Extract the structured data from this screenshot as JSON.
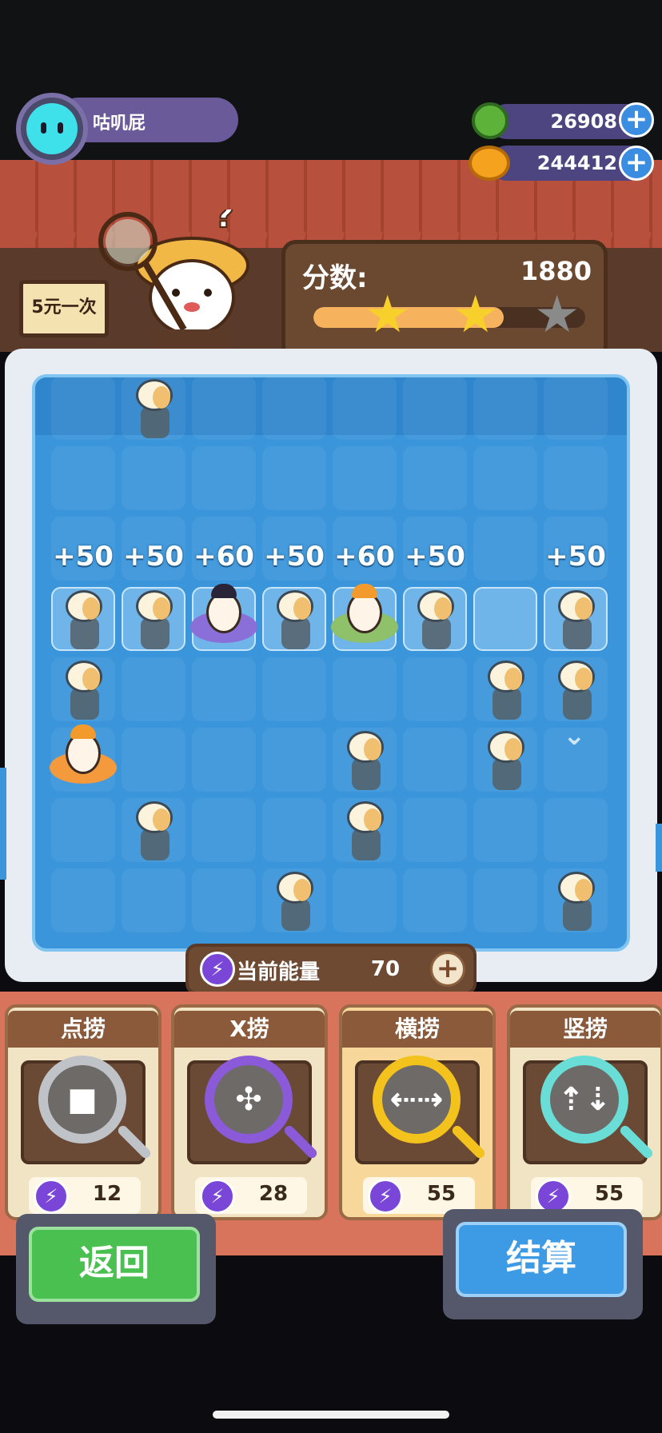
{
  "player": {
    "name": "咕叽屁"
  },
  "currencies": [
    {
      "id": "gem",
      "icon": "green-coin-icon",
      "value": "26908"
    },
    {
      "id": "gold",
      "icon": "planet-coin-icon",
      "value": "244412"
    }
  ],
  "shop_sign": "5元一次",
  "score": {
    "label": "分数:",
    "value": "1880",
    "progress": 0.7,
    "stars_earned": 2,
    "stars_total": 3
  },
  "board": {
    "cols": 8,
    "rows": 8,
    "bonus_labels": [
      {
        "col": 0,
        "text": "+50"
      },
      {
        "col": 1,
        "text": "+50"
      },
      {
        "col": 2,
        "text": "+60"
      },
      {
        "col": 3,
        "text": "+50"
      },
      {
        "col": 4,
        "text": "+60"
      },
      {
        "col": 5,
        "text": "+50"
      },
      {
        "col": 7,
        "text": "+50"
      }
    ],
    "highlighted_row": 3,
    "pieces": [
      {
        "type": "jellyfish",
        "col": 1,
        "row": 0
      },
      {
        "type": "jellyfish",
        "col": 0,
        "row": 3
      },
      {
        "type": "jellyfish",
        "col": 1,
        "row": 3
      },
      {
        "type": "duck-purple-ring",
        "col": 2,
        "row": 3
      },
      {
        "type": "jellyfish",
        "col": 3,
        "row": 3
      },
      {
        "type": "duck-green-ring",
        "col": 4,
        "row": 3
      },
      {
        "type": "jellyfish",
        "col": 5,
        "row": 3
      },
      {
        "type": "jellyfish",
        "col": 7,
        "row": 3
      },
      {
        "type": "jellyfish",
        "col": 0,
        "row": 4
      },
      {
        "type": "jellyfish",
        "col": 6,
        "row": 4
      },
      {
        "type": "jellyfish",
        "col": 7,
        "row": 4
      },
      {
        "type": "duck-orange-ring",
        "col": 0,
        "row": 5
      },
      {
        "type": "jellyfish",
        "col": 4,
        "row": 5
      },
      {
        "type": "jellyfish",
        "col": 6,
        "row": 5
      },
      {
        "type": "jellyfish",
        "col": 1,
        "row": 6
      },
      {
        "type": "jellyfish",
        "col": 4,
        "row": 6
      },
      {
        "type": "jellyfish",
        "col": 3,
        "row": 7
      },
      {
        "type": "jellyfish",
        "col": 7,
        "row": 7
      }
    ]
  },
  "energy": {
    "label": "当前能量",
    "value": "70"
  },
  "tools": [
    {
      "name": "点捞",
      "cost": "12",
      "icon": "square-lens-icon",
      "lens_color": "#bfc3c8",
      "glyph": "■",
      "selected": false
    },
    {
      "name": "X捞",
      "cost": "28",
      "icon": "diamond-lens-icon",
      "lens_color": "#8a5ad8",
      "glyph": "✣",
      "selected": false
    },
    {
      "name": "横捞",
      "cost": "55",
      "icon": "horizontal-arrows-lens-icon",
      "lens_color": "#f3c21c",
      "glyph": "⇠⇢",
      "selected": true
    },
    {
      "name": "竖捞",
      "cost": "55",
      "icon": "vertical-arrows-lens-icon",
      "lens_color": "#69ddd6",
      "glyph": "⇡⇣",
      "selected": false
    }
  ],
  "buttons": {
    "back": "返回",
    "settle": "结算"
  }
}
